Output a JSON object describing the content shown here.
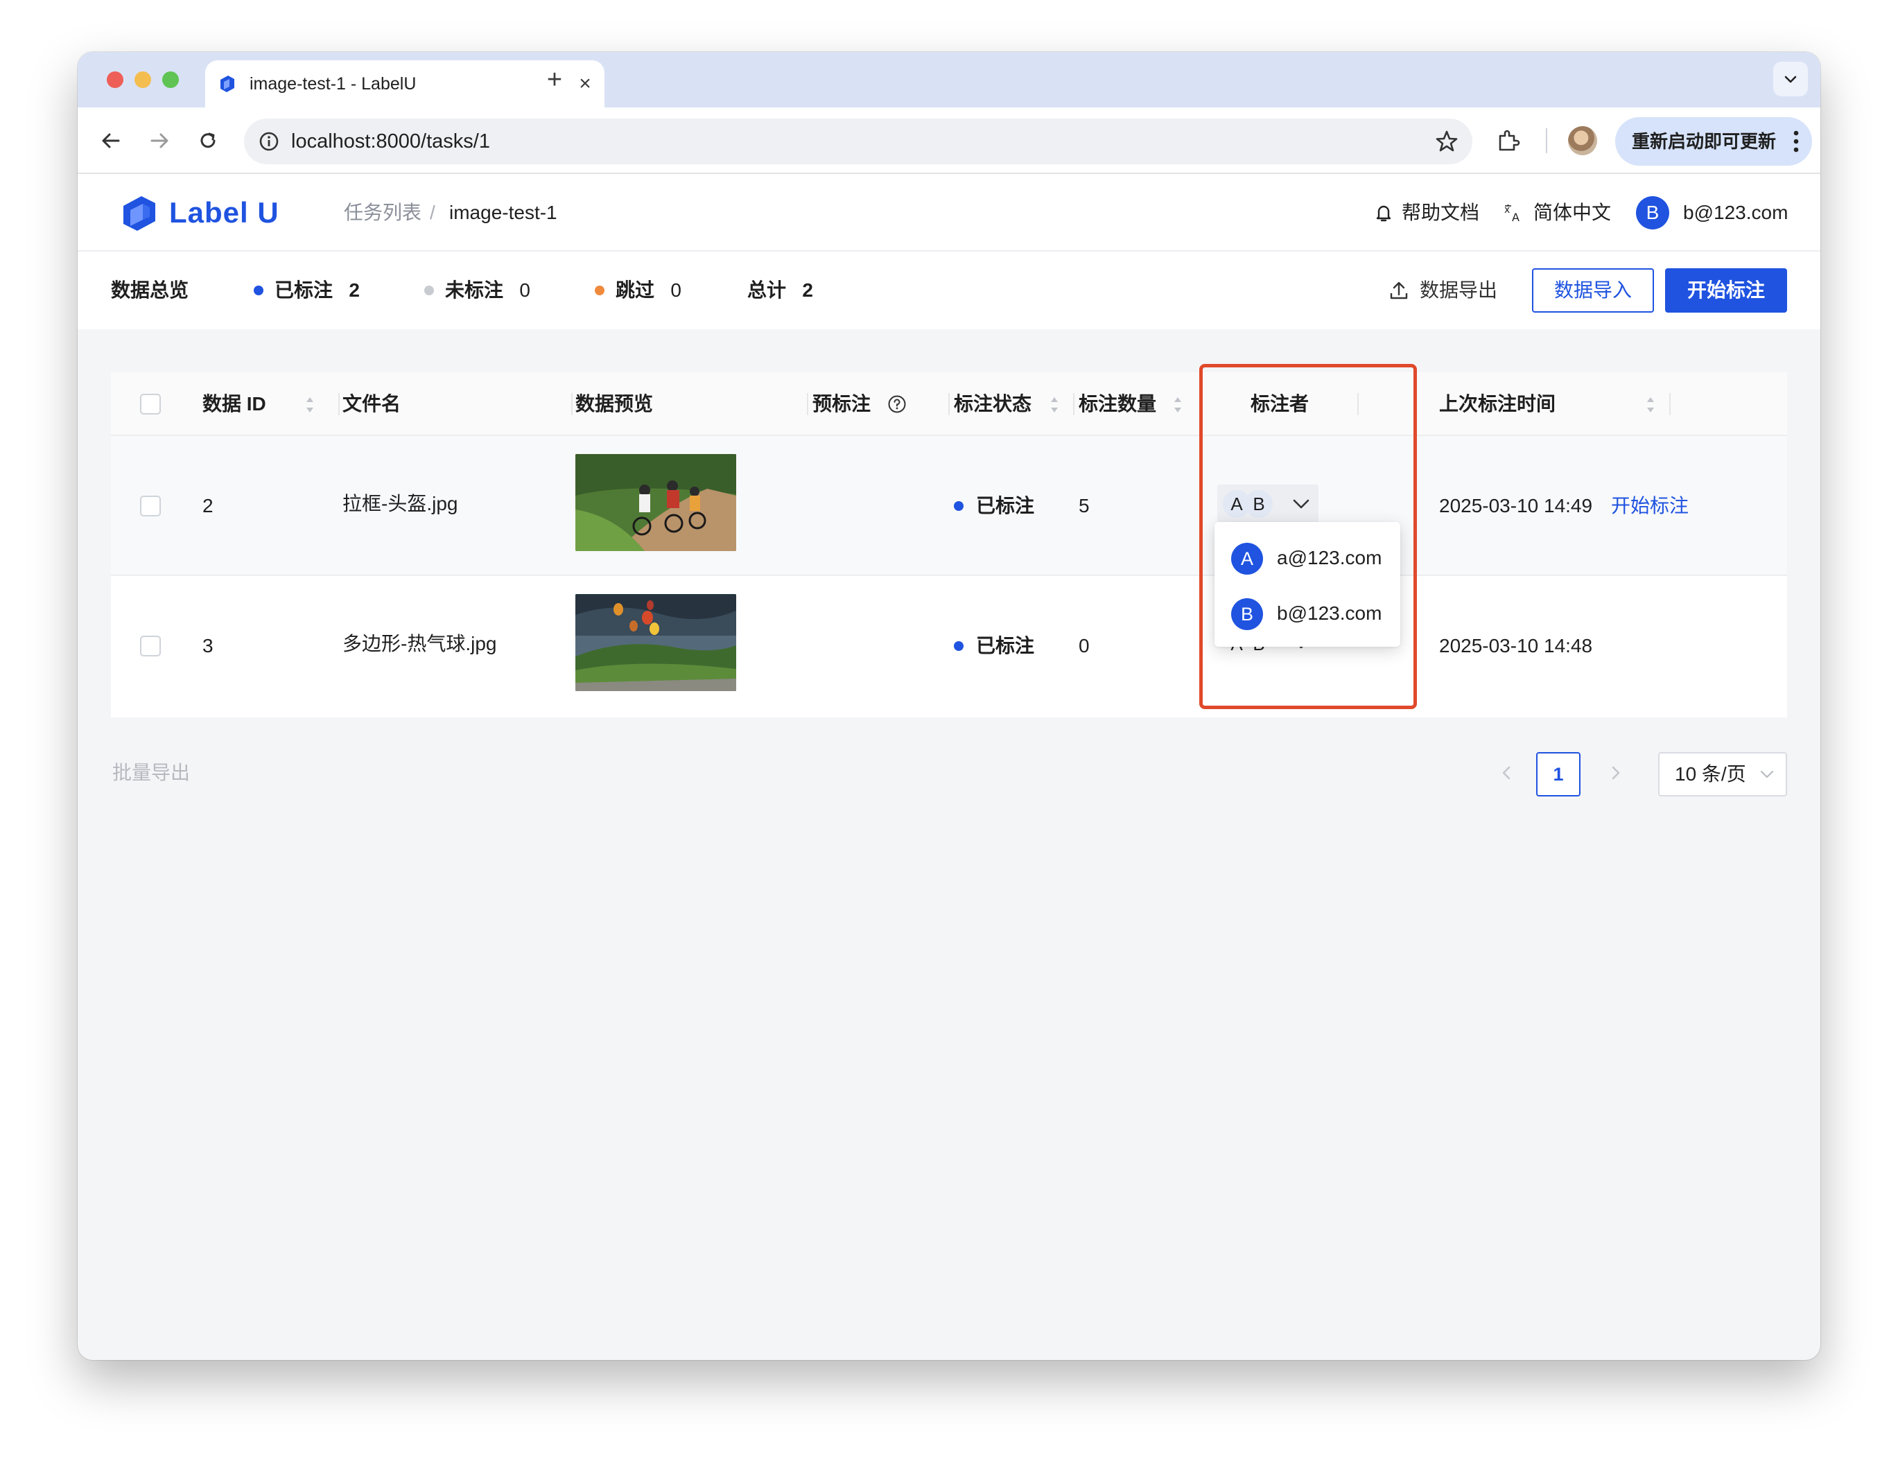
{
  "browser": {
    "tab_title": "image-test-1 - LabelU",
    "url": "localhost:8000/tasks/1",
    "relaunch_label": "重新启动即可更新",
    "icons": [
      "back-icon",
      "forward-icon",
      "reload-icon",
      "info-icon",
      "star-icon",
      "extensions-icon",
      "more-vert-icon"
    ]
  },
  "app": {
    "logo_text": "Label U",
    "brand_color": "#1f53e0",
    "breadcrumb": {
      "parent": "任务列表",
      "separator": "/",
      "current": "image-test-1"
    },
    "header": {
      "help": "帮助文档",
      "language": "简体中文",
      "user_initial": "B",
      "user_email": "b@123.com"
    }
  },
  "stats": {
    "overview_label": "数据总览",
    "annotated": {
      "label": "已标注",
      "count": "2",
      "color": "#1f53e0"
    },
    "unannotated": {
      "label": "未标注",
      "count": "0",
      "color": "#c8cbd0"
    },
    "skipped": {
      "label": "跳过",
      "count": "0",
      "color": "#f08a3c"
    },
    "total": {
      "label": "总计",
      "count": "2"
    },
    "export_label": "数据导出",
    "import_label": "数据导入",
    "start_label": "开始标注"
  },
  "table": {
    "columns": [
      "数据 ID",
      "文件名",
      "数据预览",
      "预标注",
      "标注状态",
      "标注数量",
      "标注者",
      "上次标注时间"
    ],
    "rows": [
      {
        "id": "2",
        "filename": "拉框-头盔.jpg",
        "status": "已标注",
        "count": "5",
        "annotators": [
          "A",
          "B"
        ],
        "last_time": "2025-03-10 14:49",
        "action": "开始标注"
      },
      {
        "id": "3",
        "filename": "多边形-热气球.jpg",
        "status": "已标注",
        "count": "0",
        "annotators": [
          "A",
          "B"
        ],
        "last_time": "2025-03-10 14:48",
        "action": ""
      }
    ]
  },
  "annotator_dropdown": {
    "items": [
      {
        "initial": "A",
        "email": "a@123.com"
      },
      {
        "initial": "B",
        "email": "b@123.com"
      }
    ],
    "highlight_color": "#e0492b"
  },
  "footer": {
    "batch_export": "批量导出",
    "current_page": "1",
    "page_size": "10 条/页"
  }
}
